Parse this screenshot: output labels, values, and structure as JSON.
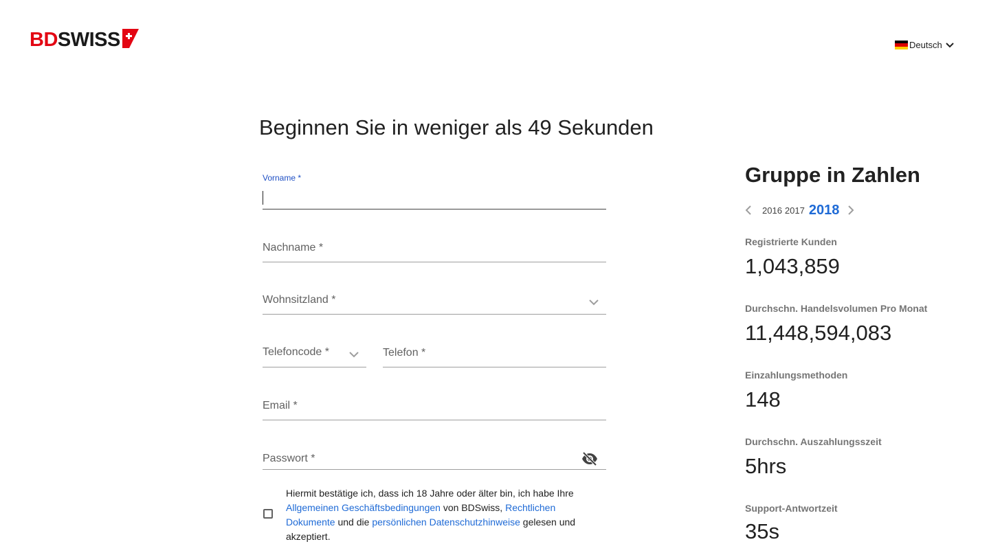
{
  "header": {
    "logo_bd": "BD",
    "logo_swiss": "SWISS",
    "language": {
      "label": "Deutsch",
      "flag": "german-flag-icon"
    }
  },
  "page_title": "Beginnen Sie in weniger als 49 Sekunden",
  "form": {
    "first_name": {
      "label": "Vorname *",
      "value": ""
    },
    "last_name": {
      "label": "Nachname *",
      "value": ""
    },
    "country": {
      "label": "Wohnsitzland *",
      "value": ""
    },
    "phone_code": {
      "label": "Telefoncode *",
      "value": ""
    },
    "phone": {
      "label": "Telefon *",
      "value": ""
    },
    "email": {
      "label": "Email *",
      "value": ""
    },
    "password": {
      "label": "Passwort *",
      "value": ""
    },
    "terms": {
      "text_1": "Hiermit bestätige ich, dass ich 18 Jahre oder älter bin, ich habe Ihre ",
      "link_1": "Allgemeinen Geschäftsbedingungen",
      "text_2": " von BDSwiss, ",
      "link_2": "Rechtlichen Dokumente",
      "text_3": " und die ",
      "link_3": "persönlichen Datenschutzhinweise",
      "text_4": " gelesen und akzeptiert.",
      "checked": false
    }
  },
  "stats": {
    "title": "Gruppe in Zahlen",
    "years": [
      "2016",
      "2017",
      "2018"
    ],
    "active_year": "2018",
    "items": [
      {
        "label": "Registrierte Kunden",
        "value": "1,043,859"
      },
      {
        "label": "Durchschn. Handelsvolumen Pro Monat",
        "value": "11,448,594,083"
      },
      {
        "label": "Einzahlungsmethoden",
        "value": "148"
      },
      {
        "label": "Durchschn. Auszahlungsszeit",
        "value": "5hrs"
      },
      {
        "label": "Support-Antwortzeit",
        "value": "35s"
      }
    ]
  },
  "colors": {
    "brand_red": "#e30613",
    "accent_blue": "#1e6ad6",
    "focus_blue": "#1e4fc4"
  }
}
